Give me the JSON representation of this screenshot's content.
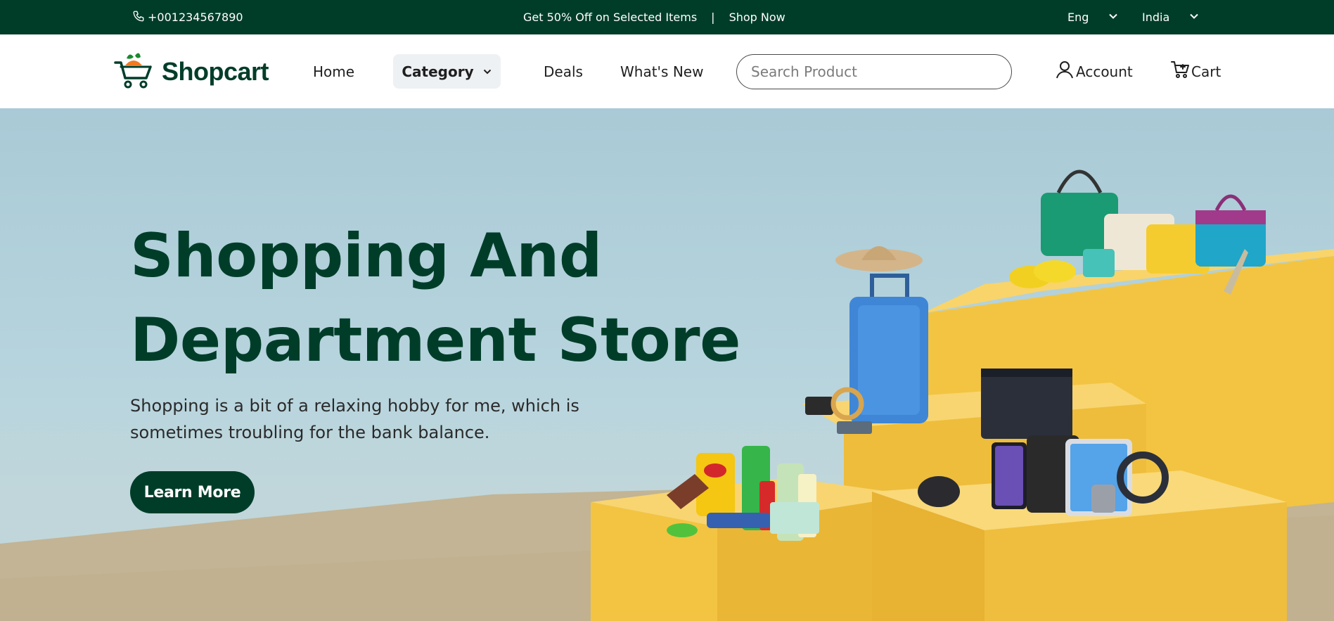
{
  "topbar": {
    "phone": "+001234567890",
    "promo_text": "Get 50% Off on Selected Items",
    "separator": "|",
    "promo_link": "Shop Now",
    "language": "Eng",
    "country": "India",
    "phone_icon": "phone-icon",
    "dropdown_icon": "chevron-down-icon"
  },
  "header": {
    "brand": "Shopcart",
    "logo_icon": "shopping-cart-logo-icon",
    "nav": {
      "home": "Home",
      "category": "Category",
      "deals": "Deals",
      "whats_new": "What's New"
    },
    "search_placeholder": "Search Product",
    "account": "Account",
    "cart": "Cart",
    "account_icon": "user-icon",
    "cart_icon": "cart-icon"
  },
  "hero": {
    "title_line1": "Shopping And",
    "title_line2": "Department Store",
    "description": "Shopping is a bit of a relaxing hobby for me, which is sometimes troubling for the bank balance.",
    "cta": "Learn More"
  },
  "colors": {
    "brand_dark_green": "#003d29",
    "topbar_bg": "#003d29",
    "category_bg": "#eef1f4",
    "hero_bg": "#b5d2dc",
    "podium_yellow": "#f6c94e"
  }
}
